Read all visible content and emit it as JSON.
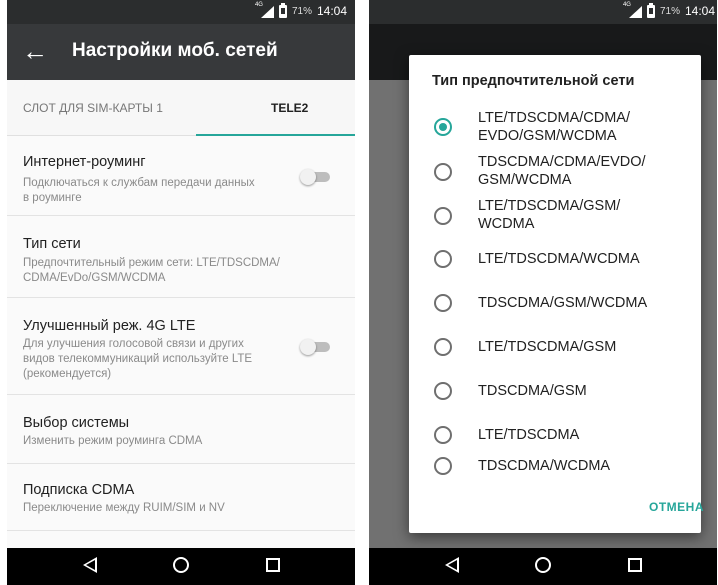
{
  "status_bar": {
    "battery_pct": "71%",
    "time": "14:04",
    "network_tag": "4G"
  },
  "left": {
    "toolbar": {
      "title": "Настройки моб. сетей"
    },
    "tabs": [
      {
        "label": "СЛОТ ДЛЯ SIM-КАРТЫ 1"
      },
      {
        "label": "TELE2"
      }
    ],
    "items": [
      {
        "title": "Интернет-роуминг",
        "subtitle": "Подключаться к службам передачи данных в роуминге",
        "toggle": false
      },
      {
        "title": "Тип сети",
        "subtitle": "Предпочтительный режим сети: LTE/TDSCDMA/ CDMA/EvDo/GSM/WCDMA"
      },
      {
        "title": "Улучшенный реж. 4G LTE",
        "subtitle": "Для улучшения голосовой связи и других видов телекоммуникаций используйте LTE (рекомендуется)",
        "toggle": false
      },
      {
        "title": "Выбор системы",
        "subtitle": "Изменить режим роуминга CDMA"
      },
      {
        "title": "Подписка CDMA",
        "subtitle": "Переключение между RUIM/SIM и NV"
      }
    ]
  },
  "dialog": {
    "title": "Тип предпочтительной сети",
    "selected_index": 0,
    "options": [
      {
        "label": "LTE/TDSCDMA/CDMA/ EVDO/GSM/WCDMA"
      },
      {
        "label": "TDSCDMA/CDMA/EVDO/ GSM/WCDMA"
      },
      {
        "label": "LTE/TDSCDMA/GSM/ WCDMA"
      },
      {
        "label": "LTE/TDSCDMA/WCDMA"
      },
      {
        "label": "TDSCDMA/GSM/WCDMA"
      },
      {
        "label": "LTE/TDSCDMA/GSM"
      },
      {
        "label": "TDSCDMA/GSM"
      },
      {
        "label": "LTE/TDSCDMA"
      },
      {
        "label": "TDSCDMA/WCDMA"
      }
    ],
    "cancel_label": "ОТМЕНА"
  },
  "colors": {
    "accent": "#26a69a",
    "toolbar": "#37393b",
    "status_bar": "#2b2d2e"
  }
}
